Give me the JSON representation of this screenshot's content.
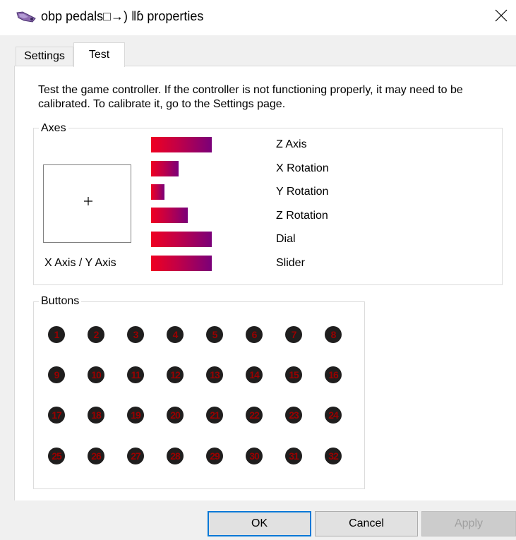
{
  "window": {
    "title": "obp pedals□→) ‖ɓ properties",
    "close_icon": "close-icon",
    "app_icon": "game-controller-icon"
  },
  "tabs": [
    {
      "label": "Settings",
      "selected": false
    },
    {
      "label": "Test",
      "selected": true
    }
  ],
  "description": "Test the game controller.  If the controller is not functioning properly, it may need to be calibrated.  To calibrate it, go to the Settings page.",
  "axes": {
    "group_label": "Axes",
    "xy_caption": "X Axis / Y Axis",
    "xy_cursor_icon": "crosshair-plus-icon",
    "items": [
      {
        "label": "Z Axis",
        "level": 1.0
      },
      {
        "label": "X Rotation",
        "level": 0.45
      },
      {
        "label": "Y Rotation",
        "level": 0.22
      },
      {
        "label": "Z Rotation",
        "level": 0.61
      },
      {
        "label": "Dial",
        "level": 1.0
      },
      {
        "label": "Slider",
        "level": 1.0
      }
    ],
    "bar_gradient": [
      "#ef0021",
      "#c00048",
      "#7a0079"
    ]
  },
  "buttons": {
    "group_label": "Buttons",
    "numbers": [
      "1",
      "2",
      "3",
      "4",
      "5",
      "6",
      "7",
      "8",
      "9",
      "10",
      "11",
      "12",
      "13",
      "14",
      "15",
      "16",
      "17",
      "18",
      "19",
      "20",
      "21",
      "22",
      "23",
      "24",
      "25",
      "26",
      "27",
      "28",
      "29",
      "30",
      "31",
      "32"
    ],
    "button_color": "#1f1e1e",
    "number_color": "#9a0000"
  },
  "dialog_buttons": {
    "ok": "OK",
    "cancel": "Cancel",
    "apply": "Apply"
  },
  "colors": {
    "accent": "#0078d7",
    "background": "#f0f0f0",
    "panel": "#ffffff"
  }
}
